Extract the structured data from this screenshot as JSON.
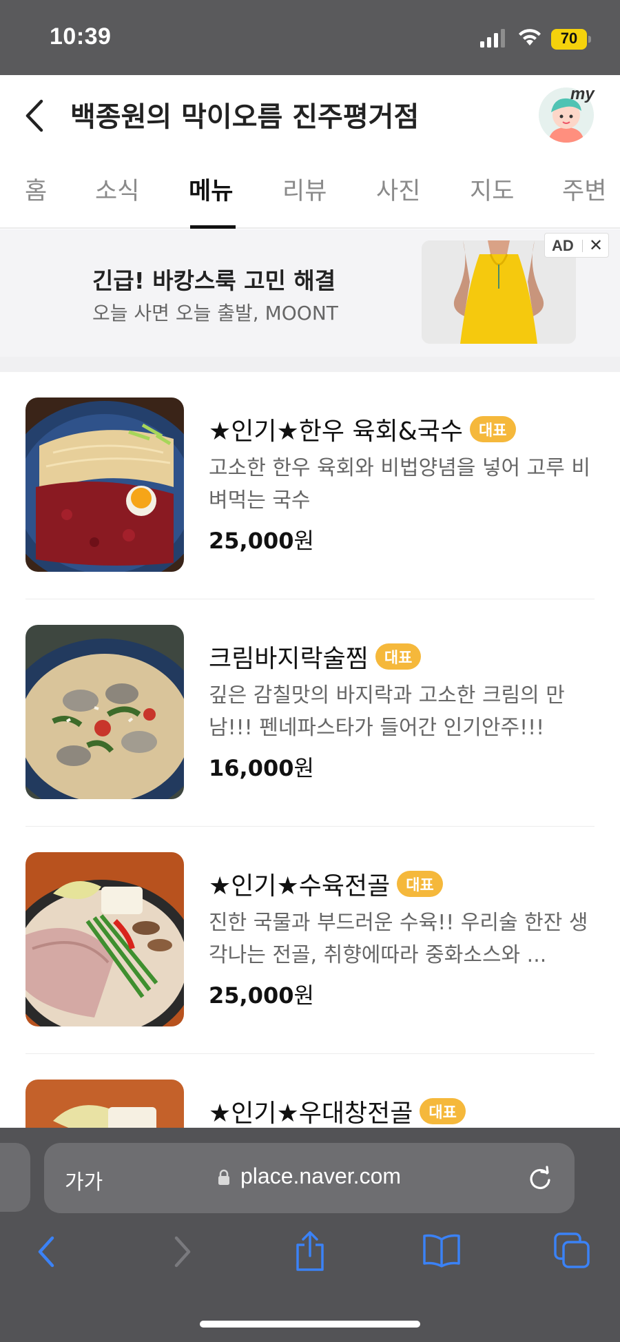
{
  "status_bar": {
    "time": "10:39",
    "battery_level": "70",
    "icons": [
      "signal-icon",
      "wifi-icon",
      "battery-icon"
    ]
  },
  "header": {
    "title": "백종원의 막이오름 진주평거점",
    "back_icon": "chevron-left-icon",
    "avatar_label": "my"
  },
  "tabs": [
    {
      "label": "홈",
      "active": false
    },
    {
      "label": "소식",
      "active": false
    },
    {
      "label": "메뉴",
      "active": true
    },
    {
      "label": "리뷰",
      "active": false
    },
    {
      "label": "사진",
      "active": false
    },
    {
      "label": "지도",
      "active": false
    },
    {
      "label": "주변",
      "active": false
    }
  ],
  "ad": {
    "title": "긴급! 바캉스룩 고민 해결",
    "subtitle": "오늘 사면 오늘 출발, MOONT",
    "badge": "AD",
    "close": "✕"
  },
  "menu": {
    "items": [
      {
        "name": "★인기★한우 육회&국수",
        "badge": "대표",
        "description": "고소한 한우 육회와 비법양념을 넣어 고루 비벼먹는 국수",
        "price_number": "25,000",
        "price_unit": "원"
      },
      {
        "name": "크림바지락술찜",
        "badge": "대표",
        "description": "깊은 감칠맛의 바지락과 고소한 크림의 만남!!! 펜네파스타가 들어간 인기안주!!!",
        "price_number": "16,000",
        "price_unit": "원"
      },
      {
        "name": "★인기★수육전골",
        "badge": "대표",
        "description": "진한 국물과 부드러운 수육!! 우리술 한잔 생각나는 전골, 취향에따라 중화소스와 ...",
        "price_number": "25,000",
        "price_unit": "원"
      },
      {
        "name": "★인기★우대창전골",
        "badge": "대표",
        "description": "",
        "price_number": "",
        "price_unit": ""
      }
    ]
  },
  "browser": {
    "text_size_label": "가가",
    "url": "place.naver.com",
    "icons": [
      "lock-icon",
      "reload-icon",
      "back-arrow-icon",
      "forward-arrow-icon",
      "share-icon",
      "bookmarks-icon",
      "tabs-icon"
    ]
  },
  "colors": {
    "badge": "#f5b83b",
    "status_bar": "#5a5a5c",
    "browser_bar": "#535356",
    "accent_blue": "#3478f6"
  }
}
